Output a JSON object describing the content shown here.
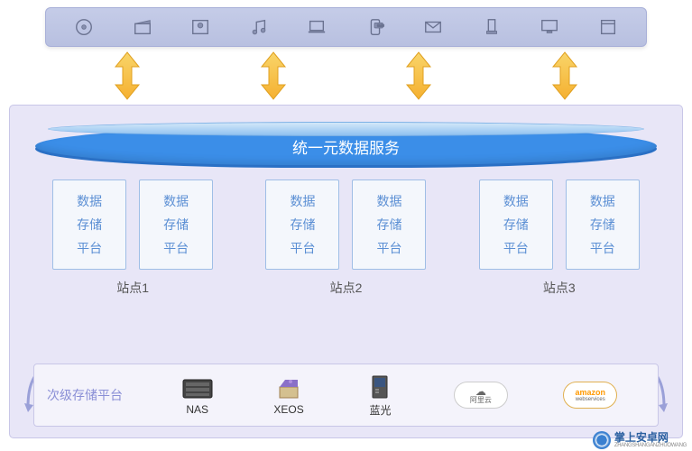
{
  "topIcons": [
    "disc",
    "clapper",
    "photo",
    "music",
    "laptop",
    "sms",
    "mail",
    "phone",
    "desktop",
    "window"
  ],
  "serviceBar": "统一元数据服务",
  "card": {
    "l1": "数据",
    "l2": "存储",
    "l3": "平台"
  },
  "sites": [
    "站点1",
    "站点2",
    "站点3"
  ],
  "storage": {
    "title": "次级存储平台",
    "items": [
      {
        "label": "NAS",
        "icon": "nas"
      },
      {
        "label": "XEOS",
        "icon": "xeos"
      },
      {
        "label": "蓝光",
        "icon": "bluray"
      },
      {
        "label": "阿里云",
        "icon": "aliyun"
      },
      {
        "label": "amazon",
        "sub": "webservices",
        "icon": "aws"
      }
    ]
  },
  "watermark": {
    "main": "掌上安卓网",
    "sub": "ZHANGSHANGANZHUOWANG"
  }
}
